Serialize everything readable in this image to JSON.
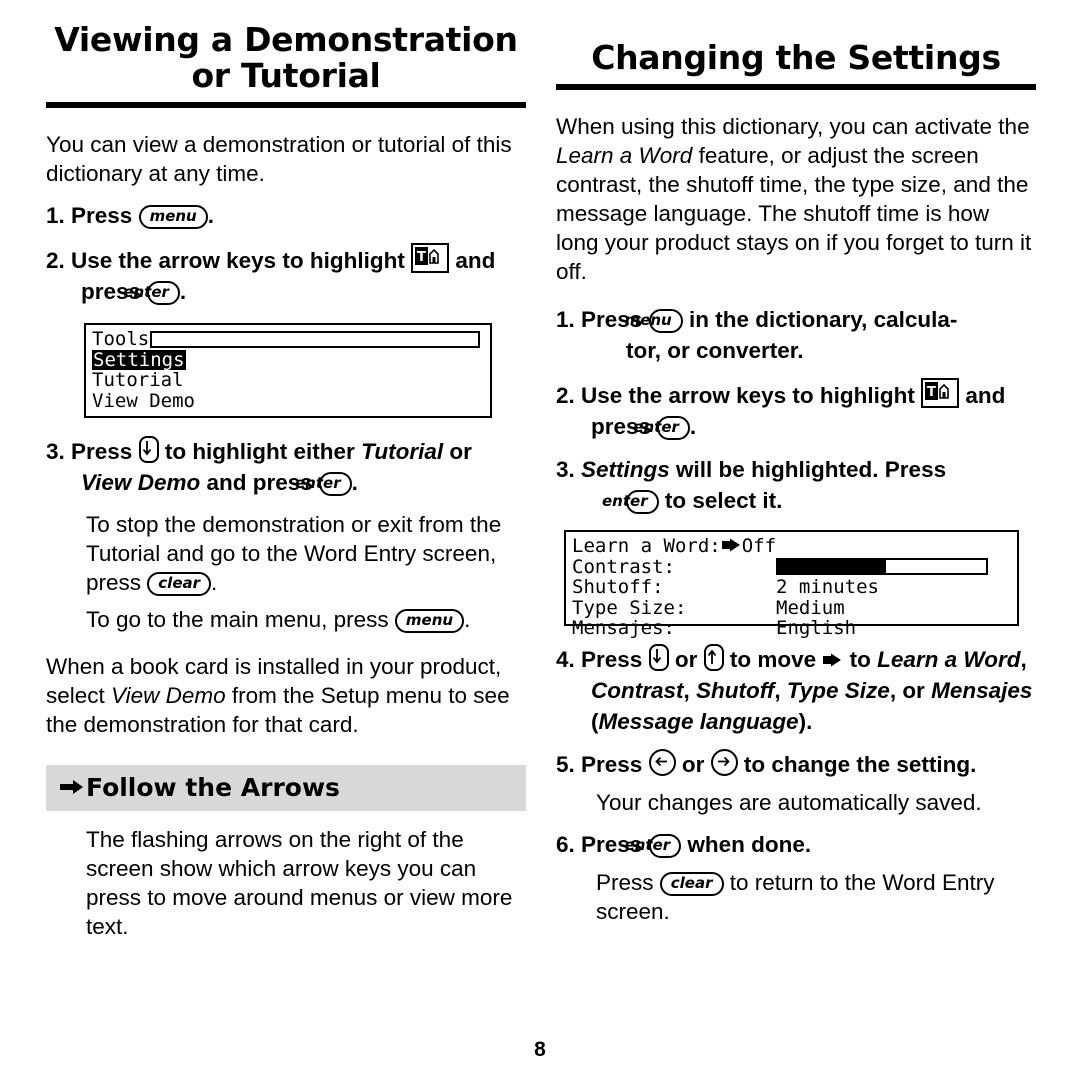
{
  "page": {
    "number": "8"
  },
  "left": {
    "title": "Viewing a Demonstration or Tutorial",
    "intro": "You can view a demonstration or tutorial of this dictionary at any time.",
    "step1_pre": "1. Press ",
    "step1_key": "menu",
    "step1_post": ".",
    "step2_pre": "2. Use the arrow keys to highlight ",
    "step2_mid": " and press ",
    "step2_key": "enter",
    "step2_post": ".",
    "lcd": {
      "row1": "Tools",
      "row2": "Settings",
      "row3": "Tutorial",
      "row4": "View Demo"
    },
    "step3_a": "3. Press ",
    "step3_b": " to highlight either ",
    "step3_c": "Tutorial",
    "step3_d": " or ",
    "step3_e": "View Demo",
    "step3_f": " and press ",
    "step3_key": "enter",
    "step3_g": ".",
    "sub1_a": "To stop the demonstration or exit from the Tutorial and go to the Word Entry screen,  press ",
    "sub1_key": "clear",
    "sub1_b": ".",
    "sub2_a": "To go to the main menu, press ",
    "sub2_key": "menu",
    "sub2_b": ".",
    "para2_a": "When a book card is installed in your product, select ",
    "para2_ital": "View Demo",
    "para2_b": " from the Setup menu to see the demonstration for that card.",
    "banner": "Follow the Arrows",
    "banner_text": "The flashing arrows on the right of the screen show which arrow keys you can press to move around menus or view more text."
  },
  "right": {
    "title": "Changing the Settings",
    "intro_a": "When using this dictionary, you can activate the ",
    "intro_ital": "Learn a Word",
    "intro_b": " feature, or adjust the screen contrast, the shutoff time, the type size, and the message language. The shutoff time is how long your product stays on if you forget to turn it off.",
    "step1_a": "1. Press ",
    "step1_key": "menu",
    "step1_b": " in the dictionary, calcula-",
    "step1_c": "tor, or converter.",
    "step2_a": "2. Use the arrow keys to highlight ",
    "step2_b": " and press ",
    "step2_key": "enter",
    "step2_c": ".",
    "step3_a": "3. ",
    "step3_ital": "Settings",
    "step3_b": " will be highlighted. Press ",
    "step3_key": "enter",
    "step3_c": " to select it.",
    "lcd": {
      "row1_label": "Learn a Word:",
      "row1_value": "Off",
      "row2_label": "Contrast:",
      "row3_label": "Shutoff:",
      "row3_value": "2 minutes",
      "row4_label": "Type Size:",
      "row4_value": "Medium",
      "row5_label": "Mensajes:",
      "row5_value": "English"
    },
    "step4_a": "4. Press ",
    "step4_b": " or ",
    "step4_c": " to move ",
    "step4_d": " to ",
    "step4_ital1": "Learn a Word",
    "step4_e": ", ",
    "step4_ital2": "Contrast",
    "step4_f": ", ",
    "step4_ital3": "Shutoff",
    "step4_g": ", ",
    "step4_ital4": "Type Size",
    "step4_h": ", or ",
    "step4_ital5": "Mensajes",
    "step4_i": " (",
    "step4_ital6": "Message language",
    "step4_j": ").",
    "step5_a": "5. Press ",
    "step5_b": " or ",
    "step5_c": " to change the setting.",
    "sub5": "Your changes are automatically saved.",
    "step6_a": "6. Press ",
    "step6_key": "enter",
    "step6_b": " when done.",
    "sub6_a": "Press ",
    "sub6_key": "clear",
    "sub6_b": " to return to the Word Entry screen."
  }
}
